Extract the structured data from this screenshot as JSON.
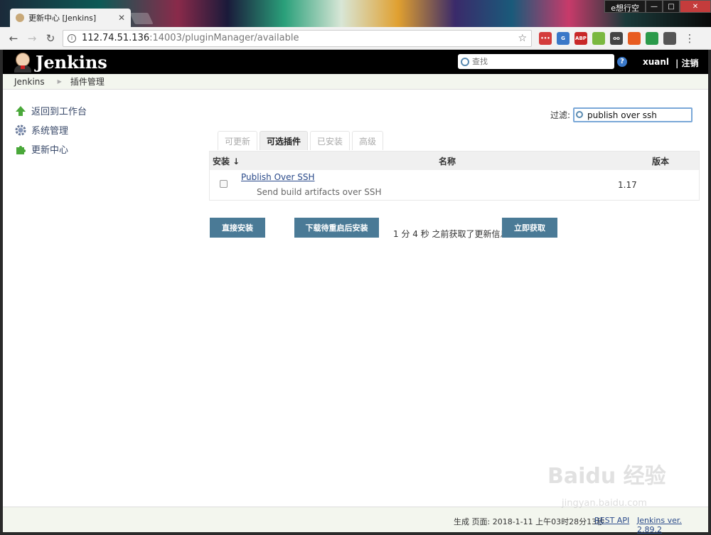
{
  "browser": {
    "tab_title": "更新中心 [Jenkins]",
    "tab_close": "✕",
    "window_user": "e想行空",
    "url_host": "112.74.51.136",
    "url_path": ":14003/pluginManager/available",
    "star": "☆",
    "back": "←",
    "forward": "→",
    "reload": "↻",
    "menu": "⋮",
    "extensions": [
      "•••",
      "G",
      "ABP",
      "",
      "oo",
      "",
      "",
      ""
    ],
    "ext_colors": [
      "#d43c3c",
      "#3a78c8",
      "#c82828",
      "#7ab840",
      "#444444",
      "#e85c20",
      "#2a9a4a",
      "#555555"
    ]
  },
  "header": {
    "brand": "Jenkins",
    "search_placeholder": "查找",
    "help": "?",
    "user": "xuanl",
    "logout": "| 注销"
  },
  "breadcrumbs": [
    "Jenkins",
    "插件管理"
  ],
  "sidebar": {
    "items": [
      {
        "label": "返回到工作台",
        "icon": "up-arrow-icon"
      },
      {
        "label": "系统管理",
        "icon": "gear-icon"
      },
      {
        "label": "更新中心",
        "icon": "puzzle-icon"
      }
    ]
  },
  "filter": {
    "label": "过滤:",
    "value": "publish over ssh"
  },
  "tabs": [
    {
      "label": "可更新",
      "active": false
    },
    {
      "label": "可选插件",
      "active": true
    },
    {
      "label": "已安装",
      "active": false
    },
    {
      "label": "高级",
      "active": false
    }
  ],
  "table": {
    "headers": {
      "install": "安装 ↓",
      "name": "名称",
      "version": "版本"
    },
    "rows": [
      {
        "name": "Publish Over SSH",
        "description": "Send build artifacts over SSH",
        "version": "1.17",
        "checked": false
      }
    ]
  },
  "actions": {
    "install_now": "直接安装",
    "install_after_restart": "下载待重启后安装",
    "status": "1 分 4 秒 之前获取了更新信息",
    "check_now": "立即获取"
  },
  "footer": {
    "generated": "生成 页面: 2018-1-11 上午03时28分13秒",
    "rest_api": "REST API",
    "version": "Jenkins ver. 2.89.2"
  },
  "watermark": {
    "main": "Baidu 经验",
    "sub": "jingyan.baidu.com"
  }
}
